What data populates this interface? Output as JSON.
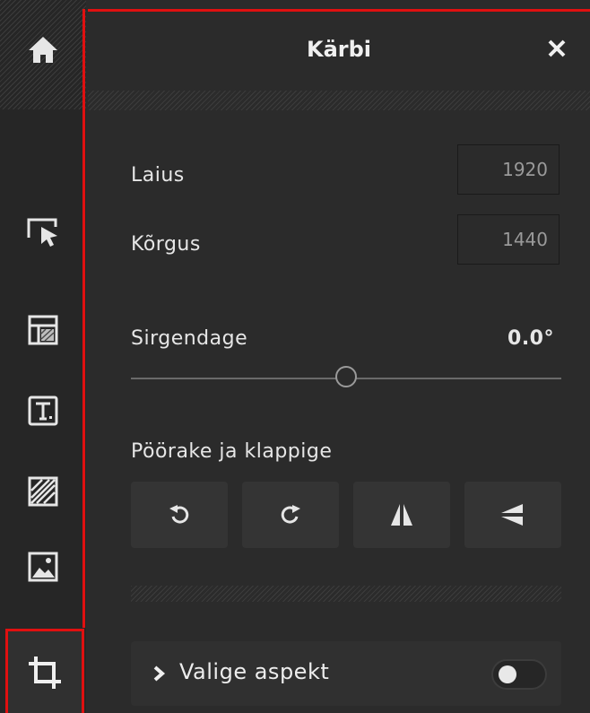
{
  "sidebar": {
    "tools": [
      {
        "icon": "home-icon"
      },
      {
        "icon": "select-pointer-icon"
      },
      {
        "icon": "layout-icon"
      },
      {
        "icon": "text-icon"
      },
      {
        "icon": "pattern-icon"
      },
      {
        "icon": "image-icon"
      },
      {
        "icon": "crop-icon",
        "active": true
      }
    ]
  },
  "panel": {
    "title": "Kärbi",
    "close_icon": "close-icon",
    "width_label": "Laius",
    "width_value": "1920",
    "height_label": "Kõrgus",
    "height_value": "1440",
    "straighten_label": "Sirgendage",
    "straighten_value": "0.0°",
    "straighten_level": 0.5,
    "rotate_flip_label": "Pöörake ja klappige",
    "rotate_buttons": [
      {
        "icon": "rotate-left-icon"
      },
      {
        "icon": "rotate-right-icon"
      },
      {
        "icon": "flip-horizontal-icon"
      },
      {
        "icon": "flip-vertical-icon"
      }
    ],
    "aspect_label": "Valige aspekt",
    "aspect_toggle_on": false
  },
  "colors": {
    "highlight_border": "#e01010",
    "panel_bg": "#2b2b2b",
    "sidebar_bg": "#262626"
  }
}
